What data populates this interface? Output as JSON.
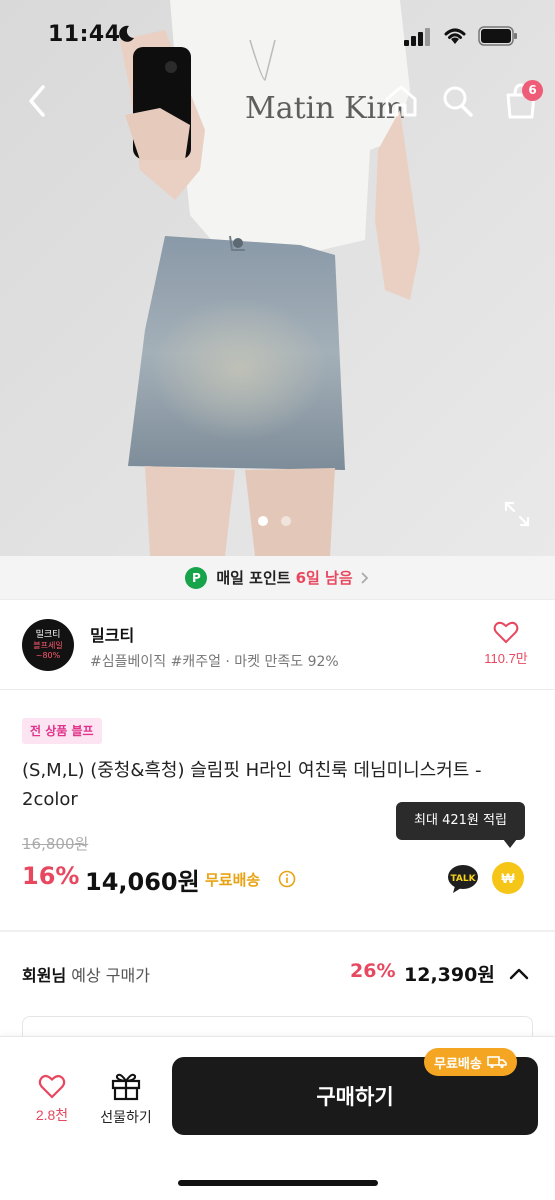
{
  "status_bar": {
    "time": "11:44"
  },
  "nav": {
    "cart_count": "6"
  },
  "points_banner": {
    "p_label": "P",
    "text": "매일 포인트",
    "days": "6일 남음"
  },
  "shop": {
    "logo_line1": "밀크티",
    "logo_line2": "블프세일",
    "logo_line3": "~80%",
    "name": "밀크티",
    "tags": "#심플베이직 #캐주얼 · 마켓 만족도 92%",
    "favorite_count": "110.7만"
  },
  "product": {
    "sale_tag": "전 상품 블프",
    "title": "(S,M,L) (중청&흑청) 슬림핏 H라인 여친룩 데님미니스커트 - 2color",
    "tooltip": "최대 421원 적립",
    "original_price": "16,800원",
    "discount": "16%",
    "price": "14,060원",
    "shipping": "무료배송",
    "talk_label": "TALK",
    "won_label": "₩"
  },
  "member": {
    "label_bold": "회원님",
    "label_rest": " 예상 구매가",
    "discount": "26%",
    "price": "12,390원"
  },
  "bottom_bar": {
    "like_count": "2.8천",
    "gift_label": "선물하기",
    "buy_label": "구매하기",
    "ship_badge": "무료배송"
  },
  "colors": {
    "accent": "#e8485f",
    "shipping": "#e8a314",
    "buy_button": "#1a1a1a",
    "points_green": "#16a34a"
  },
  "icons": [
    "back-icon",
    "home-icon",
    "search-icon",
    "cart-icon",
    "expand-icon",
    "heart-icon",
    "gift-icon",
    "truck-icon",
    "info-icon",
    "chevron-up-icon"
  ]
}
